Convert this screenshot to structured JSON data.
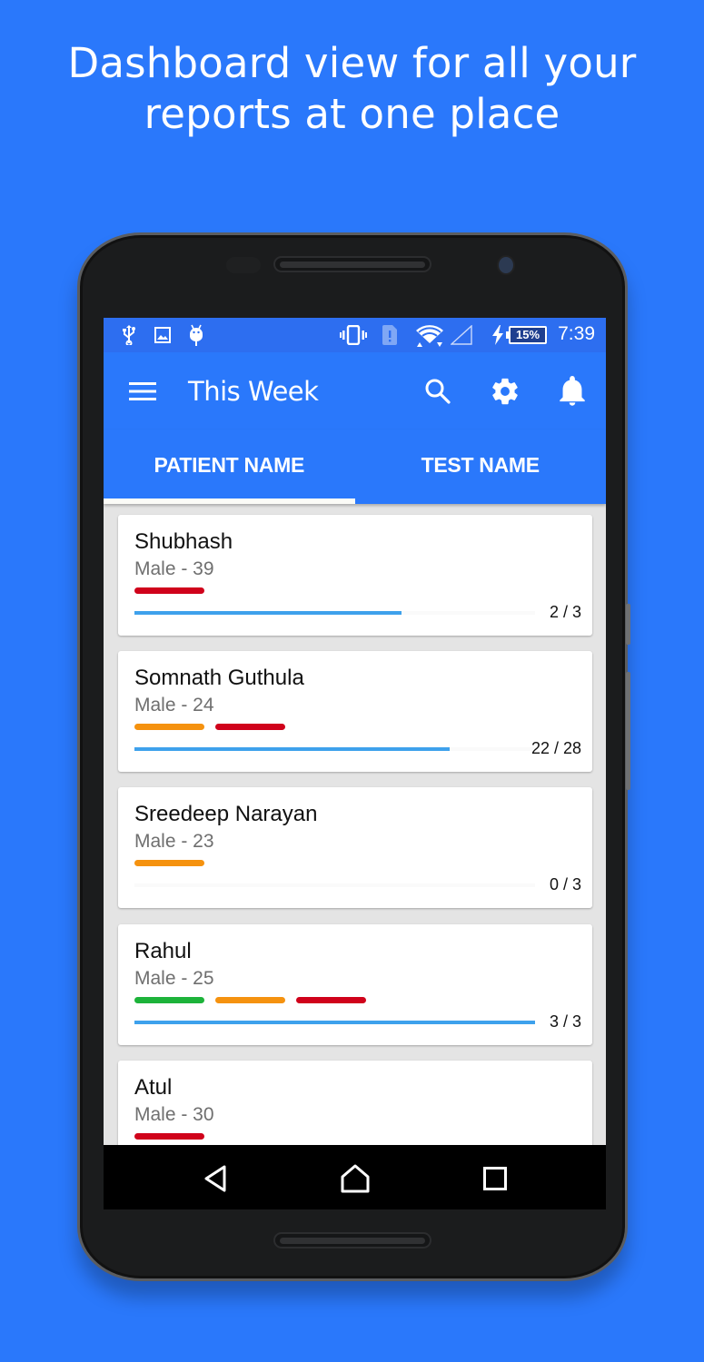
{
  "promo": {
    "headline_line1": "Dashboard view for all your",
    "headline_line2": "reports at one place"
  },
  "status_bar": {
    "left_icons": [
      "usb-icon",
      "image-icon",
      "android-debug-icon"
    ],
    "right_icons": [
      "vibrate-icon",
      "sim-alert-icon",
      "wifi-icon",
      "cell-signal-icon",
      "charging-icon"
    ],
    "battery_percent": "15%",
    "time": "7:39"
  },
  "app_bar": {
    "title": "This Week",
    "icons": [
      "menu-icon",
      "search-icon",
      "settings-icon",
      "notifications-icon"
    ]
  },
  "tabs": [
    {
      "label": "PATIENT NAME",
      "selected": true
    },
    {
      "label": "TEST NAME",
      "selected": false
    }
  ],
  "colors": {
    "primary": "#2a78fb",
    "status_bar": "#2d6ef0",
    "progress": "#3ea1ec",
    "flag_red": "#d0021b",
    "flag_orange": "#f5920f",
    "flag_green": "#1db33a"
  },
  "patients": [
    {
      "name": "Shubhash",
      "details": "Male - 39",
      "flags": [
        "#d0021b"
      ],
      "completed": 2,
      "total": 3,
      "count_label": "2 / 3"
    },
    {
      "name": "Somnath Guthula",
      "details": "Male - 24",
      "flags": [
        "#f5920f",
        "#d0021b"
      ],
      "completed": 22,
      "total": 28,
      "count_label": "22 / 28"
    },
    {
      "name": "Sreedeep Narayan",
      "details": "Male - 23",
      "flags": [
        "#f5920f"
      ],
      "completed": 0,
      "total": 3,
      "count_label": "0 / 3"
    },
    {
      "name": "Rahul",
      "details": "Male - 25",
      "flags": [
        "#1db33a",
        "#f5920f",
        "#d0021b"
      ],
      "completed": 3,
      "total": 3,
      "count_label": "3 / 3"
    },
    {
      "name": "Atul",
      "details": "Male - 30",
      "flags": [
        "#d0021b"
      ],
      "completed": null,
      "total": null,
      "count_label": ""
    }
  ],
  "nav_bar": {
    "buttons": [
      "back-icon",
      "home-icon",
      "recents-icon"
    ]
  }
}
